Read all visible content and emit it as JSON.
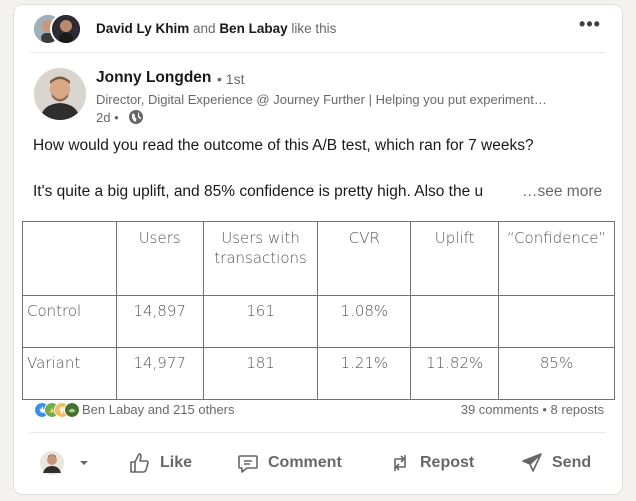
{
  "social": {
    "name1": "David Ly Khim",
    "and": " and ",
    "name2": "Ben Labay",
    "suffix": " like this",
    "more": "•••"
  },
  "author": {
    "name": "Jonny Longden",
    "degree": "• 1st",
    "headline": "Director, Digital Experience @ Journey Further | Helping you put experiment…",
    "time": "2d •"
  },
  "post": {
    "line1": "How would you read the outcome of this A/B test, which ran for 7 weeks?",
    "line2": "It's quite a big uplift, and 85% confidence is pretty high. Also the u",
    "see_more": "…see more"
  },
  "table": {
    "headers": [
      "",
      "Users",
      "Users with transactions",
      "CVR",
      "Uplift",
      "“Confidence”"
    ],
    "rows": [
      [
        "Control",
        "14,897",
        "161",
        "1.08%",
        "",
        ""
      ],
      [
        "Variant",
        "14,977",
        "181",
        "1.21%",
        "11.82%",
        "85%"
      ]
    ]
  },
  "reactions": {
    "text": "Ben Labay and 215 others",
    "counts": "39 comments • 8 reposts",
    "icons": [
      "like-icon",
      "celebrate-icon",
      "insightful-icon",
      "support-icon"
    ]
  },
  "actions": {
    "like": "Like",
    "comment": "Comment",
    "repost": "Repost",
    "send": "Send"
  },
  "colors": {
    "background": "#f4f2ee",
    "card": "#ffffff",
    "like_blue": "#378fe9",
    "text_muted": "#666666"
  }
}
